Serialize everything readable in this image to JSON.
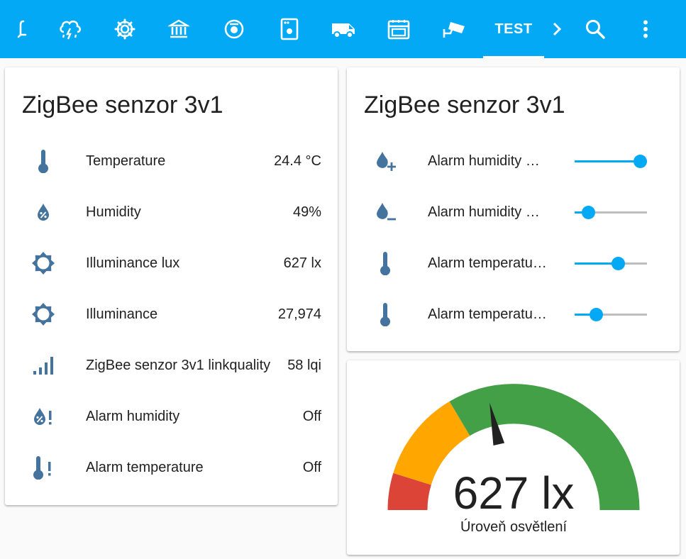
{
  "colors": {
    "toolbar": "#03a9f4",
    "icon": "#44739e",
    "slider": "#03a9f4",
    "gauge_red": "#db4437",
    "gauge_orange": "#ffa600",
    "gauge_green": "#43a047"
  },
  "toolbar": {
    "icons": [
      "cable-icon",
      "weather-lightning-rainy-icon",
      "cog-icon",
      "bank-icon",
      "robot-vacuum-icon",
      "washing-machine-icon",
      "van-icon",
      "oven-icon",
      "cctv-icon"
    ],
    "active_tab": "TEST"
  },
  "sensor_card": {
    "title": "ZigBee senzor 3v1",
    "rows": [
      {
        "icon": "thermometer-icon",
        "label": "Temperature",
        "value": "24.4 °C"
      },
      {
        "icon": "water-percent-icon",
        "label": "Humidity",
        "value": "49%"
      },
      {
        "icon": "brightness-icon",
        "label": "Illuminance lux",
        "value": "627 lx"
      },
      {
        "icon": "brightness-icon",
        "label": "Illuminance",
        "value": "27,974"
      },
      {
        "icon": "signal-icon",
        "label": "ZigBee senzor 3v1 linkquality",
        "value": "58 lqi"
      },
      {
        "icon": "water-alert-icon",
        "label": "Alarm humidity",
        "value": "Off"
      },
      {
        "icon": "thermometer-alert-icon",
        "label": "Alarm temperature",
        "value": "Off"
      }
    ]
  },
  "slider_card": {
    "title": "ZigBee senzor 3v1",
    "rows": [
      {
        "icon": "water-plus-icon",
        "label": "Alarm humidity …",
        "level": 0.9
      },
      {
        "icon": "water-minus-icon",
        "label": "Alarm humidity …",
        "level": 0.19
      },
      {
        "icon": "thermometer-icon",
        "label": "Alarm temperatu…",
        "level": 0.6
      },
      {
        "icon": "thermometer-icon",
        "label": "Alarm temperatu…",
        "level": 0.29
      }
    ]
  },
  "gauge_card": {
    "value_text": "627 lx",
    "label": "Úroveň osvětlení",
    "level": 0.43
  }
}
